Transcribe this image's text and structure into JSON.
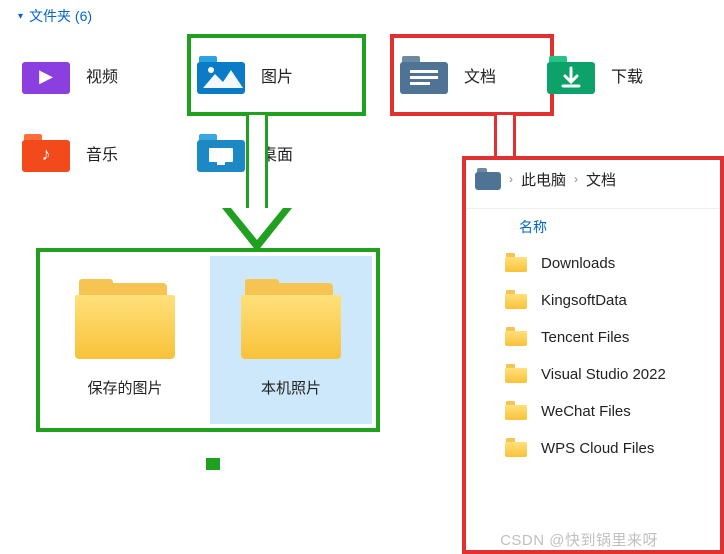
{
  "section": {
    "title": "文件夹 (6)"
  },
  "libs": {
    "videos": {
      "label": "视频",
      "color_tab": "#a760e8",
      "color_body": "#8b3fe0",
      "glyph": "▶"
    },
    "pictures": {
      "label": "图片",
      "color_tab": "#2aa4e0",
      "color_body": "#0a7bc7",
      "glyph": ""
    },
    "documents": {
      "label": "文档",
      "color_tab": "#6c8aa0",
      "color_body": "#4e7394",
      "glyph": ""
    },
    "downloads": {
      "label": "下载",
      "color_tab": "#25c28a",
      "color_body": "#0ea26b",
      "glyph": ""
    },
    "music": {
      "label": "音乐",
      "color_tab": "#ff6e3a",
      "color_body": "#f24a1a",
      "glyph": "♪"
    },
    "desktop": {
      "label": "桌面",
      "color_tab": "#3aa8e0",
      "color_body": "#1d89c4",
      "glyph": ""
    }
  },
  "pictures_view": {
    "items": [
      {
        "label": "保存的图片"
      },
      {
        "label": "本机照片"
      }
    ],
    "selected_index": 1
  },
  "documents_view": {
    "breadcrumb": {
      "root": "此电脑",
      "current": "文档"
    },
    "column": "名称",
    "items": [
      "Downloads",
      "KingsoftData",
      "Tencent Files",
      "Visual Studio 2022",
      "WeChat Files",
      "WPS Cloud Files"
    ]
  },
  "watermark": "CSDN @快到锅里来呀"
}
